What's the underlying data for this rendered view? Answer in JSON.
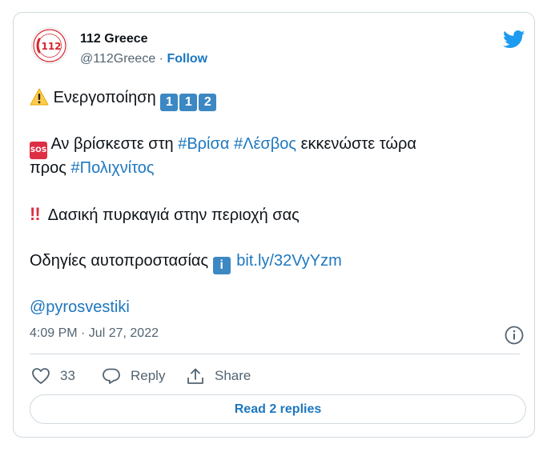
{
  "account": {
    "name": "112 Greece",
    "handle": "@112Greece",
    "separator": "·",
    "follow_label": "Follow",
    "avatar_text": "112",
    "avatar_ring_text": "ΓΕΝΙΚΗ ΓΡΑΜΜΑΤΕΙΑ ΠΟΛΙΤΙΚΗΣ ΠΡΟΣΤΑΣΙΑΣ"
  },
  "tweet": {
    "line1_text": "Ενεργοποίηση",
    "line1_keycaps": [
      "1",
      "1",
      "2"
    ],
    "sos_label": "SOS",
    "line2_text_a": "Αν βρίσκεστε στη",
    "hashtag_vrisa": "#Βρίσα",
    "hashtag_lesvos": "#Λέσβος",
    "line2_text_b": "εκκενώστε τώρα",
    "line3_text": "προς",
    "hashtag_polichnitos": "#Πολιχνίτος",
    "bang_label": "!!",
    "line4_text": "Δασική πυρκαγιά στην περιοχή σας",
    "line5_text": "Οδηγίες αυτοπροστασίας",
    "info_keycap": "i",
    "link": "bit.ly/32VyYzm",
    "mention": "@pyrosvestiki"
  },
  "meta": {
    "timestamp": "4:09 PM · Jul 27, 2022"
  },
  "actions": {
    "like_count": "33",
    "reply_label": "Reply",
    "share_label": "Share",
    "read_replies_label": "Read 2 replies"
  },
  "colors": {
    "link_blue": "#1d77bf",
    "twitter_blue": "#1d9bf0",
    "sos_red": "#dd2e44",
    "keycap_blue": "#3b88c3",
    "muted_text": "#536471"
  }
}
